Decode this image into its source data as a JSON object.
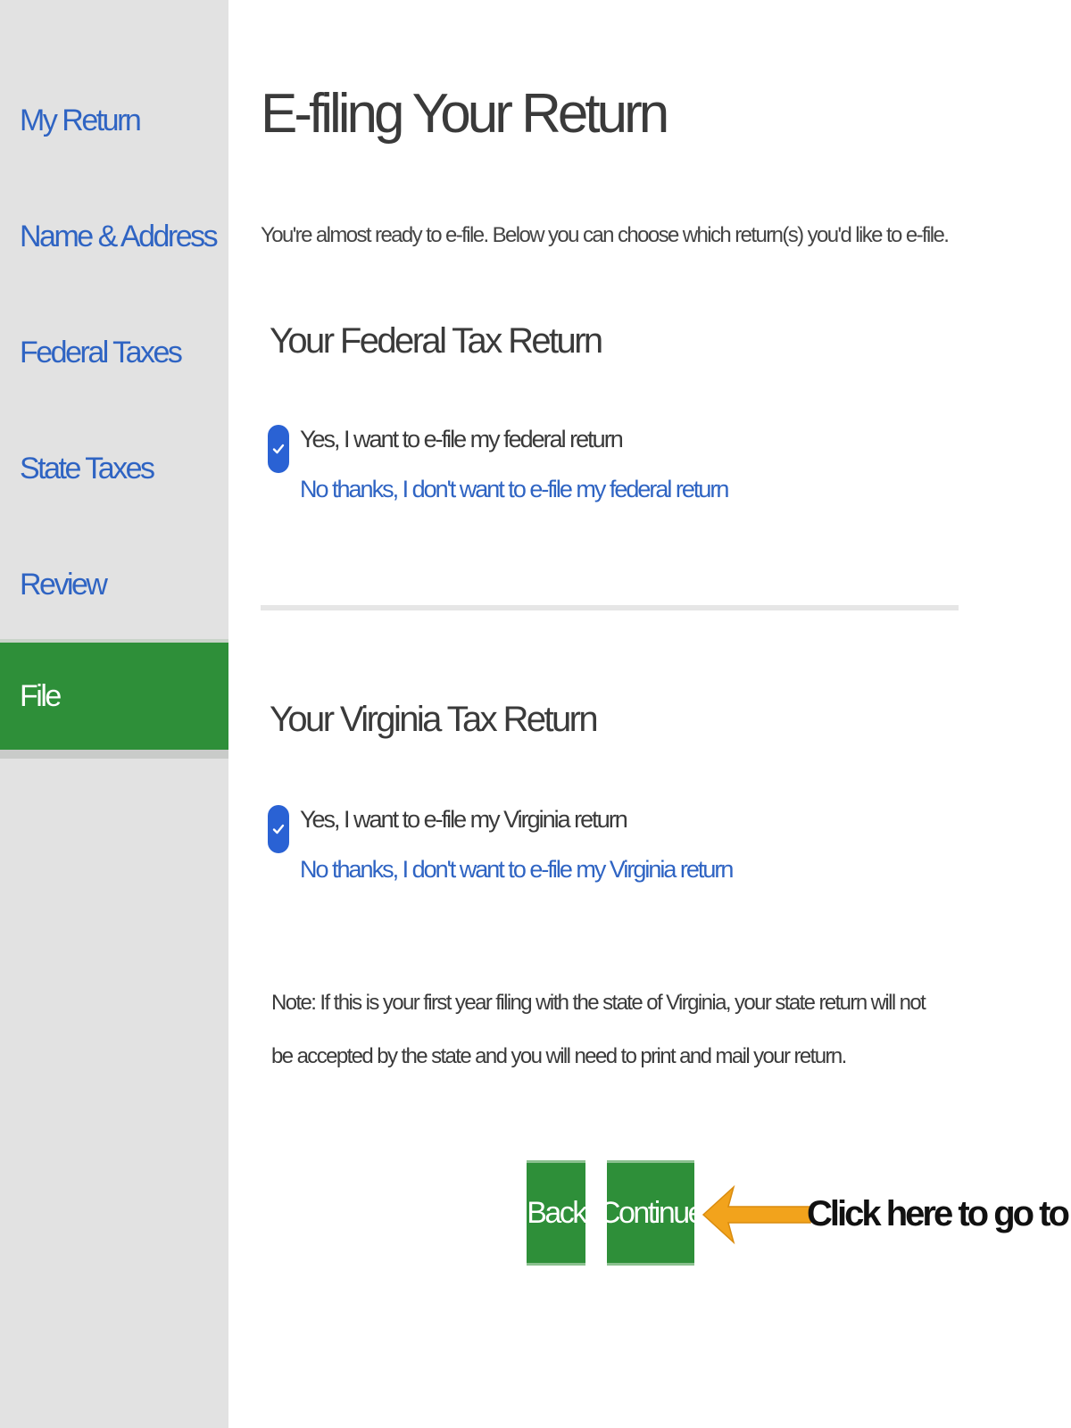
{
  "sidebar": {
    "items": [
      {
        "label": "My Return"
      },
      {
        "label": "Name & Address"
      },
      {
        "label": "Federal Taxes"
      },
      {
        "label": "State Taxes"
      },
      {
        "label": "Review"
      },
      {
        "label": "File",
        "active": true
      }
    ]
  },
  "main": {
    "title": "E-filing Your Return",
    "intro": "You're almost ready to e-file. Below you can choose which return(s) you'd like to e-file.",
    "federal": {
      "heading": "Your Federal Tax Return",
      "selected_option": "Yes, I want to e-file my federal return",
      "alt_option": "No thanks, I don't want to e-file my federal return"
    },
    "state": {
      "heading": "Your Virginia Tax Return",
      "selected_option": "Yes, I want to e-file my Virginia return",
      "alt_option": "No thanks, I don't want to e-file my Virginia return"
    },
    "note": "Note: If this is your first year filing with the state of Virginia, your state return will not be accepted by the state and you will need to print and mail your return."
  },
  "buttons": {
    "back_label": "Back",
    "continue_label": "Continue"
  },
  "annotation": {
    "callout": "Click here to go to next step"
  },
  "icons": {
    "check": "check-icon",
    "arrow": "arrow-left-icon"
  },
  "colors": {
    "accent_green": "#2e8f39",
    "link_blue": "#2f64c3",
    "checkbox_blue": "#2a62d4",
    "sidebar_bg": "#e2e2e2",
    "arrow_orange": "#f2a31c"
  }
}
